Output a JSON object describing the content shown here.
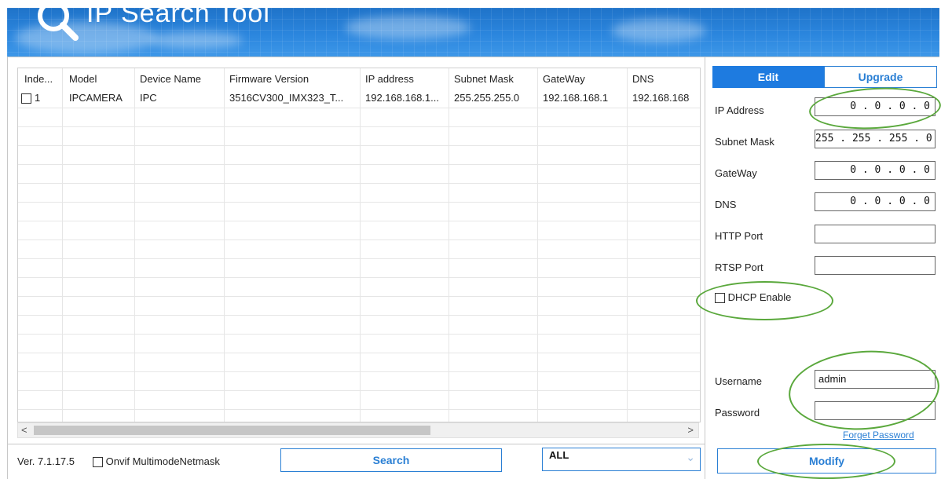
{
  "app": {
    "title": "IP Search Tool"
  },
  "table": {
    "columns": [
      "Inde...",
      "Model",
      "Device Name",
      "Firmware Version",
      "IP address",
      "Subnet Mask",
      "GateWay",
      "DNS"
    ],
    "rows": [
      {
        "index": "1",
        "model": "IPCAMERA",
        "device_name": "IPC",
        "firmware": "3516CV300_IMX323_T...",
        "ip": "192.168.168.1...",
        "mask": "255.255.255.0",
        "gateway": "192.168.168.1",
        "dns": "192.168.168"
      }
    ]
  },
  "scroll": {
    "left_arrow": "<",
    "right_arrow": ">"
  },
  "footer": {
    "version": "Ver. 7.1.17.5",
    "onvif_label": "Onvif MultimodeNetmask",
    "search_label": "Search",
    "filter_value": "ALL",
    "filter_chevron": "chevron-down-icon"
  },
  "panel": {
    "tabs": {
      "edit": "Edit",
      "upgrade": "Upgrade"
    },
    "fields": {
      "ip_address": {
        "label": "IP Address",
        "value": "0 . 0 . 0 . 0"
      },
      "subnet_mask": {
        "label": "Subnet Mask",
        "value": "255 . 255 . 255 . 0"
      },
      "gateway": {
        "label": "GateWay",
        "value": "0 . 0 . 0 . 0"
      },
      "dns": {
        "label": "DNS",
        "value": "0 . 0 . 0 . 0"
      },
      "http_port": {
        "label": "HTTP Port",
        "value": ""
      },
      "rtsp_port": {
        "label": "RTSP Port",
        "value": ""
      }
    },
    "dhcp_label": "DHCP Enable",
    "username": {
      "label": "Username",
      "value": "admin"
    },
    "password": {
      "label": "Password",
      "value": ""
    },
    "forget_password": "Forget Password",
    "modify_label": "Modify"
  },
  "colors": {
    "accent": "#1e7be0",
    "annotation": "#5aa83c",
    "banner": "#2b86de"
  }
}
